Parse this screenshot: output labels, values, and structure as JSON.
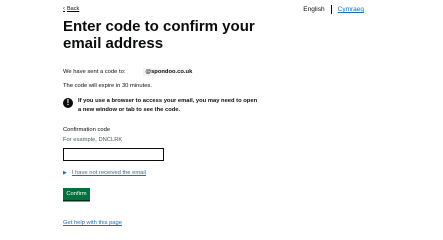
{
  "nav": {
    "back_label": "Back",
    "language_current": "English",
    "language_other": "Cymraeg"
  },
  "main": {
    "heading": "Enter code to confirm your email address",
    "sent_prefix": "We have sent a code to:",
    "email_visible": "@spondoo.co.uk",
    "expiry": "The code will expire in 30 minutes.",
    "warning_icon": "!",
    "warning": "If you use a browser to access your email, you may need to open a new window or tab to see the code."
  },
  "form": {
    "label": "Confirmation code",
    "hint": "For example, DNCLRK",
    "value": "",
    "details_summary": "I have not received the email",
    "confirm_label": "Confirm",
    "help_link": "Get help with this page"
  },
  "colors": {
    "text": "#0b0c0c",
    "link": "#1d70b8",
    "button": "#00703c",
    "hint": "#505a5f"
  }
}
